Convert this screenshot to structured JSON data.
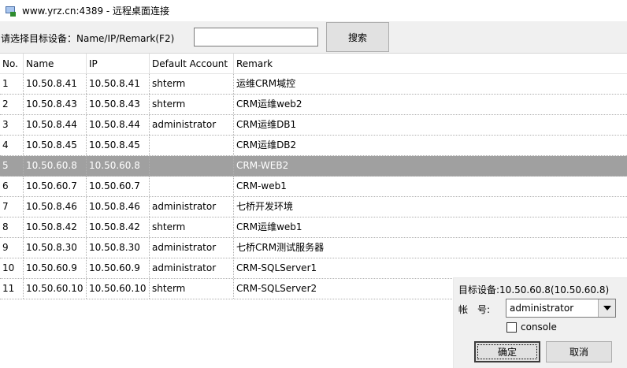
{
  "window": {
    "title": "www.yrz.cn:4389 - 远程桌面连接"
  },
  "search": {
    "label": "请选择目标设备：Name/IP/Remark(F2)",
    "value": "",
    "placeholder": "",
    "button_label": "搜索"
  },
  "table": {
    "columns": [
      "No.",
      "Name",
      "IP",
      "Default Account",
      "Remark"
    ],
    "selected_row": 5,
    "rows": [
      {
        "no": "1",
        "name": "10.50.8.41",
        "ip": "10.50.8.41",
        "account": "shterm",
        "remark": "运维CRM堿控"
      },
      {
        "no": "2",
        "name": "10.50.8.43",
        "ip": "10.50.8.43",
        "account": "shterm",
        "remark": "CRM运维web2"
      },
      {
        "no": "3",
        "name": "10.50.8.44",
        "ip": "10.50.8.44",
        "account": "administrator",
        "remark": "CRM运维DB1"
      },
      {
        "no": "4",
        "name": "10.50.8.45",
        "ip": "10.50.8.45",
        "account": "",
        "remark": "CRM运维DB2"
      },
      {
        "no": "5",
        "name": "10.50.60.8",
        "ip": "10.50.60.8",
        "account": "",
        "remark": "CRM-WEB2"
      },
      {
        "no": "6",
        "name": "10.50.60.7",
        "ip": "10.50.60.7",
        "account": "",
        "remark": "CRM-web1"
      },
      {
        "no": "7",
        "name": "10.50.8.46",
        "ip": "10.50.8.46",
        "account": "administrator",
        "remark": "七桥开发环境"
      },
      {
        "no": "8",
        "name": "10.50.8.42",
        "ip": "10.50.8.42",
        "account": "shterm",
        "remark": "CRM运维web1"
      },
      {
        "no": "9",
        "name": "10.50.8.30",
        "ip": "10.50.8.30",
        "account": "administrator",
        "remark": "七桥CRM测试服务器"
      },
      {
        "no": "10",
        "name": "10.50.60.9",
        "ip": "10.50.60.9",
        "account": "administrator",
        "remark": "CRM-SQLServer1"
      },
      {
        "no": "11",
        "name": "10.50.60.10",
        "ip": "10.50.60.10",
        "account": "shterm",
        "remark": "CRM-SQLServer2"
      }
    ]
  },
  "dialog": {
    "target_text": "目标设备:10.50.60.8(10.50.60.8)",
    "account_label": "帐　号:",
    "account_value": "administrator",
    "console_label": "console",
    "console_checked": false,
    "ok_label": "确定",
    "cancel_label": "取消"
  },
  "colors": {
    "selected_row_bg": "#a0a0a0",
    "panel_bg": "#f0f0f0"
  }
}
